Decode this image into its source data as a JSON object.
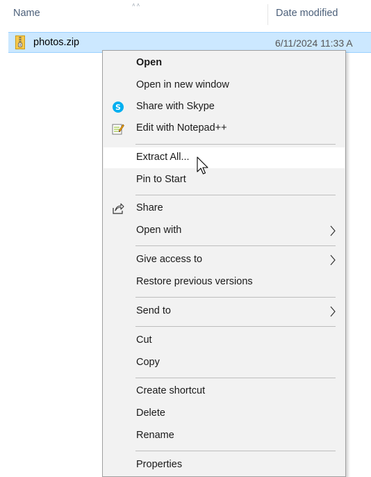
{
  "header": {
    "col_name": "Name",
    "col_date": "Date modified"
  },
  "file": {
    "name": "photos.zip",
    "date": "6/11/2024 11:33 A",
    "icon": "zip-folder-icon"
  },
  "menu": {
    "items": [
      {
        "label": "Open",
        "bold": true
      },
      {
        "label": "Open in new window"
      },
      {
        "label": "Share with Skype",
        "icon": "skype-icon"
      },
      {
        "label": "Edit with Notepad++",
        "icon": "notepad-plus-plus-icon"
      },
      {
        "label": "Extract All...",
        "hovered": true
      },
      {
        "label": "Pin to Start"
      },
      {
        "label": "Share",
        "icon": "share-icon"
      },
      {
        "label": "Open with",
        "submenu": true
      },
      {
        "label": "Give access to",
        "submenu": true
      },
      {
        "label": "Restore previous versions"
      },
      {
        "label": "Send to",
        "submenu": true
      },
      {
        "label": "Cut"
      },
      {
        "label": "Copy"
      },
      {
        "label": "Create shortcut"
      },
      {
        "label": "Delete"
      },
      {
        "label": "Rename"
      },
      {
        "label": "Properties"
      }
    ]
  },
  "colors": {
    "selection_bg": "#cce8ff",
    "selection_border": "#99d1ff",
    "menu_bg": "#f2f2f2",
    "hover_bg": "#ffffff",
    "header_text": "#4c607a",
    "skype_blue": "#00aff0"
  }
}
